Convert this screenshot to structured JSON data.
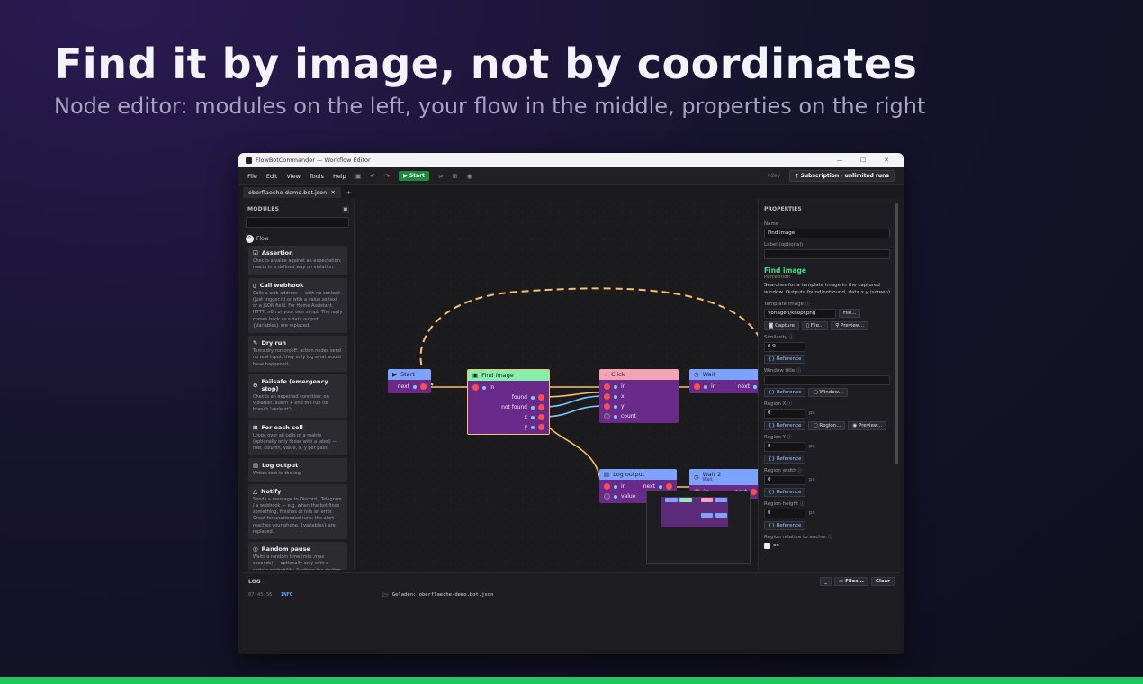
{
  "hero": {
    "title": "Find it by image, not by coordinates",
    "subtitle": "Node editor: modules on the left, your flow in the middle, properties on the right"
  },
  "window": {
    "title": "FlowBotCommander — Workflow Editor",
    "controls": [
      "—",
      "☐",
      "✕"
    ]
  },
  "menu": {
    "items": [
      "File",
      "Edit",
      "View",
      "Tools",
      "Help"
    ],
    "start_label": "Start",
    "dev_label": "vdev",
    "subscription_label": "Subscription · unlimited runs"
  },
  "tabs": {
    "active": "oberflaeche-demo.bot.json",
    "close": "✕",
    "add": "+"
  },
  "modules": {
    "header": "MODULES",
    "group": "Flow",
    "items": [
      {
        "icon": "☑",
        "title": "Assertion",
        "desc": "Checks a value against an expectation; reacts in a defined way on violation."
      },
      {
        "icon": "▯",
        "title": "Call webhook",
        "desc": "Calls a web address — with no content (just trigger it) or with a value as text or a JSON field. For Home Assistant, IFTTT, n8n or your own script. The reply comes back as a data output. {Variables} are replaced."
      },
      {
        "icon": "✎",
        "title": "Dry run",
        "desc": "Turns dry run on/off: action nodes send no real input, they only log what would have happened."
      },
      {
        "icon": "⊖",
        "title": "Failsafe (emergency stop)",
        "desc": "Checks an expected condition; on violation, alarm + end the run (or branch 'verletzt')."
      },
      {
        "icon": "⊞",
        "title": "For each cell",
        "desc": "Loops over all cells of a matrix (optionally only those with a label) — row, column, value, x, y per pass."
      },
      {
        "icon": "▤",
        "title": "Log output",
        "desc": "Writes text to the log."
      },
      {
        "icon": "△",
        "title": "Notify",
        "desc": "Sends a message to Discord / Telegram / a webhook — e.g. when the bot finds something, finishes or hits an error. Great for unattended runs; the alert reaches your phone. {variables} are replaced."
      },
      {
        "icon": "◎",
        "title": "Random pause",
        "desc": "Waits a random time (min..max seconds) — optionally only with a certain probability. Scatters the rhythm in a human, irregular way and makes bot detection by too-uniform timing harder."
      }
    ]
  },
  "canvas": {
    "nodes": {
      "start": {
        "title": "Start",
        "ports": [
          "next"
        ]
      },
      "find_image": {
        "title": "Find image",
        "in": "in",
        "outs": [
          "found",
          "not found",
          "x",
          "y"
        ]
      },
      "click": {
        "title": "Click",
        "ports": [
          "in",
          "x",
          "y",
          "count"
        ]
      },
      "wait": {
        "title": "Wait",
        "in": "in",
        "out": "next"
      },
      "log_output": {
        "title": "Log output",
        "in": "in",
        "value": "value",
        "out": "next"
      },
      "wait2": {
        "title": "Wait 2",
        "subtitle": "Wait",
        "in": "in",
        "out": "next"
      }
    },
    "colors": {
      "accent_blue": "#7ea3ff",
      "accent_green": "#86efac",
      "accent_pink": "#f4a3b4",
      "node_body": "#6a2a8a",
      "wire_exec": "#f5c26b",
      "wire_data": "#7ec8ff"
    }
  },
  "properties": {
    "header": "PROPERTIES",
    "name_label": "Name",
    "name_value": "Find image",
    "label_label": "Label (optional)",
    "label_value": "",
    "node_title": "Find image",
    "node_category": "Perception",
    "node_desc": "Searches for a template image in the captured window. Outputs found/notfound, data x,y (screen).",
    "template_label": "Template image",
    "template_value": "Vorlagen/knopf.png",
    "file_btn": "File...",
    "capture_btn": "Capture",
    "file2_btn": "File...",
    "preview_btn": "Preview...",
    "similarity_label": "Similarity",
    "similarity_value": "0.9",
    "reference_btn": "Reference",
    "window_title_label": "Window title",
    "window_title_value": "",
    "window_btn": "Window...",
    "region_x_label": "Region X",
    "region_x_value": "0",
    "region_btn": "Region...",
    "region_y_label": "Region Y",
    "region_y_value": "0",
    "region_w_label": "Region width",
    "region_w_value": "0",
    "region_h_label": "Region height",
    "region_h_value": "0",
    "px": "px",
    "anchor_label": "Region relative to anchor",
    "anchor_value": "on"
  },
  "log": {
    "header": "LOG",
    "collapse_btn": "_",
    "files_btn": "Files...",
    "clear_btn": "Clear",
    "lines": [
      {
        "time": "07:45:56",
        "level": "INFO",
        "message": "Geladen: oberflaeche-demo.bot.json"
      }
    ]
  }
}
